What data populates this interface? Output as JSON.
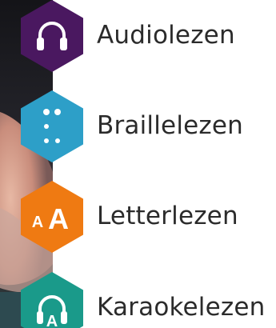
{
  "colors": {
    "audio": "#4a1860",
    "braille": "#2d9fc8",
    "letter": "#ef7a12",
    "karaoke": "#1a9a8a",
    "label_text": "#2b2b2b"
  },
  "menu": {
    "items": [
      {
        "label": "Audiolezen",
        "icon": "headphones-icon",
        "color": "#4a1860"
      },
      {
        "label": "Braillelezen",
        "icon": "braille-dots-icon",
        "color": "#2d9fc8"
      },
      {
        "label": "Letterlezen",
        "icon": "font-size-icon",
        "color": "#ef7a12",
        "icon_text": "AA"
      },
      {
        "label": "Karaokelezen",
        "icon": "karaoke-headphones-icon",
        "color": "#1a9a8a",
        "icon_text": "A"
      }
    ]
  }
}
